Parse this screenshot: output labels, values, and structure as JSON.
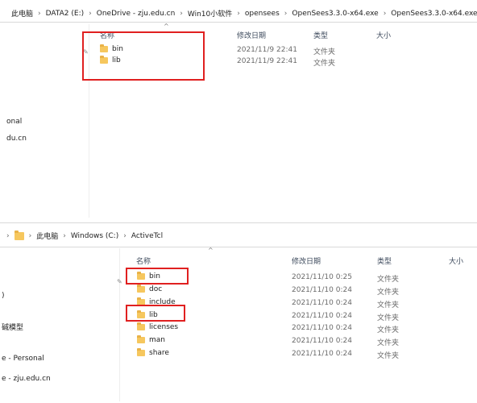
{
  "top": {
    "breadcrumb": [
      "此电脑",
      "DATA2 (E:)",
      "OneDrive - zju.edu.cn",
      "Win10小软件",
      "opensees",
      "OpenSees3.3.0-x64.exe",
      "OpenSees3.3.0-x64.exe"
    ],
    "columns": {
      "name": "名称",
      "date": "修改日期",
      "type": "类型",
      "size": "大小"
    },
    "rows": [
      {
        "name": "bin",
        "date": "2021/11/9 22:41",
        "type": "文件夹"
      },
      {
        "name": "lib",
        "date": "2021/11/9 22:41",
        "type": "文件夹"
      }
    ],
    "nav": {
      "item1": "onal",
      "item2": "du.cn"
    }
  },
  "bottom": {
    "breadcrumb": [
      "此电脑",
      "Windows (C:)",
      "ActiveTcl"
    ],
    "columns": {
      "name": "名称",
      "date": "修改日期",
      "type": "类型",
      "size": "大小"
    },
    "rows": [
      {
        "name": "bin",
        "date": "2021/11/10 0:25",
        "type": "文件夹"
      },
      {
        "name": "doc",
        "date": "2021/11/10 0:24",
        "type": "文件夹"
      },
      {
        "name": "include",
        "date": "2021/11/10 0:24",
        "type": "文件夹"
      },
      {
        "name": "lib",
        "date": "2021/11/10 0:24",
        "type": "文件夹"
      },
      {
        "name": "licenses",
        "date": "2021/11/10 0:24",
        "type": "文件夹"
      },
      {
        "name": "man",
        "date": "2021/11/10 0:24",
        "type": "文件夹"
      },
      {
        "name": "share",
        "date": "2021/11/10 0:24",
        "type": "文件夹"
      }
    ],
    "nav": {
      "item1": ")",
      "item2": "碱模型",
      "item3": "e - Personal",
      "item4": "e - zju.edu.cn"
    }
  }
}
